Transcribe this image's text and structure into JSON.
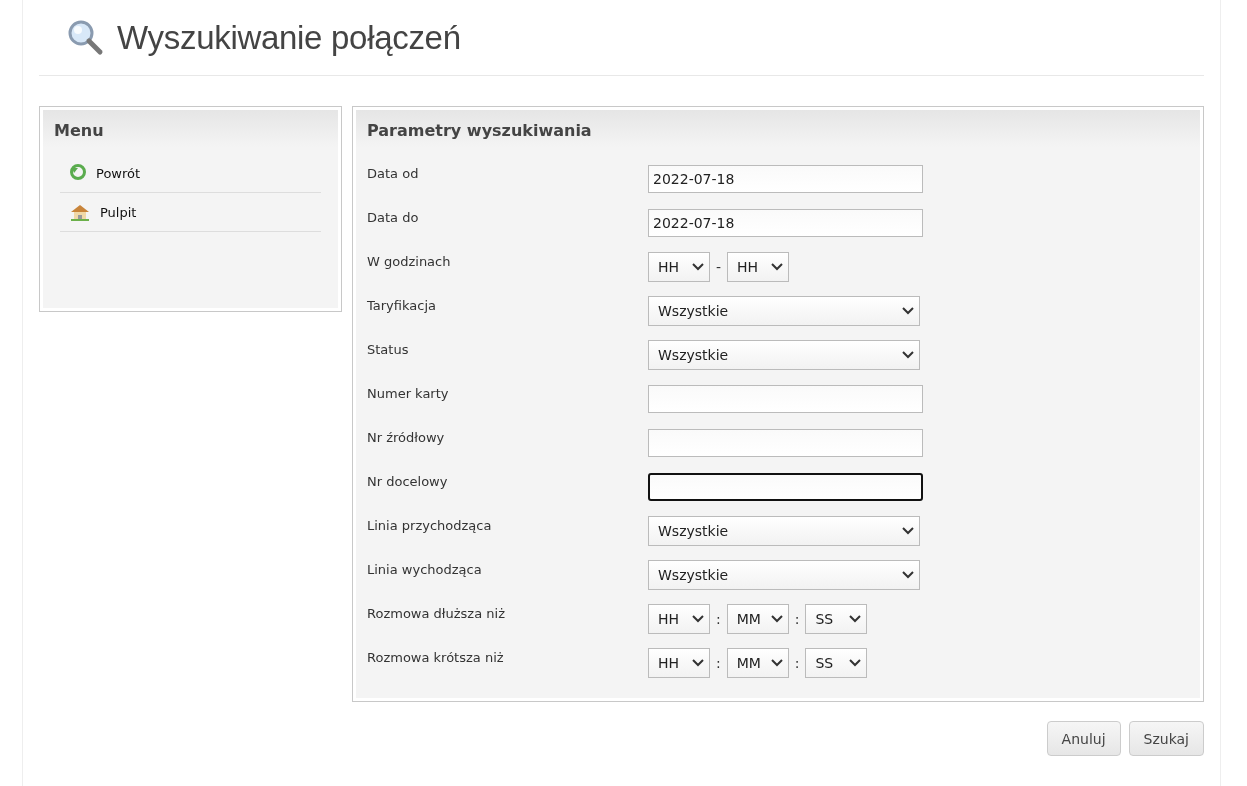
{
  "page": {
    "title": "Wyszukiwanie połączeń"
  },
  "menu": {
    "title": "Menu",
    "items": [
      {
        "label": "Powrót",
        "kind": "back"
      },
      {
        "label": "Pulpit",
        "kind": "home"
      }
    ]
  },
  "form": {
    "title": "Parametry wyszukiwania",
    "fields": [
      {
        "label": "Data od",
        "kind": "text",
        "value": "2022-07-18",
        "focused": false
      },
      {
        "label": "Data do",
        "kind": "text",
        "value": "2022-07-18",
        "focused": false
      },
      {
        "label": "W godzinach",
        "kind": "time",
        "parts": [
          "HH",
          "HH"
        ],
        "separators": [
          "-"
        ]
      },
      {
        "label": "Taryfikacja",
        "kind": "select",
        "value": "Wszystkie"
      },
      {
        "label": "Status",
        "kind": "select",
        "value": "Wszystkie"
      },
      {
        "label": "Numer karty",
        "kind": "text",
        "focused": false
      },
      {
        "label": "Nr źródłowy",
        "kind": "text",
        "focused": false
      },
      {
        "label": "Nr docelowy",
        "kind": "text",
        "focused": true
      },
      {
        "label": "Linia przychodząca",
        "kind": "select",
        "value": "Wszystkie"
      },
      {
        "label": "Linia wychodząca",
        "kind": "select",
        "value": "Wszystkie"
      },
      {
        "label": "Rozmowa dłuższa niż",
        "kind": "time",
        "parts": [
          "HH",
          "MM",
          "SS"
        ],
        "separators": [
          ":",
          ":"
        ]
      },
      {
        "label": "Rozmowa krótsza niż",
        "kind": "time",
        "parts": [
          "HH",
          "MM",
          "SS"
        ],
        "separators": [
          ":",
          ":"
        ]
      }
    ]
  },
  "buttons": [
    "Anuluj",
    "Szukaj"
  ]
}
